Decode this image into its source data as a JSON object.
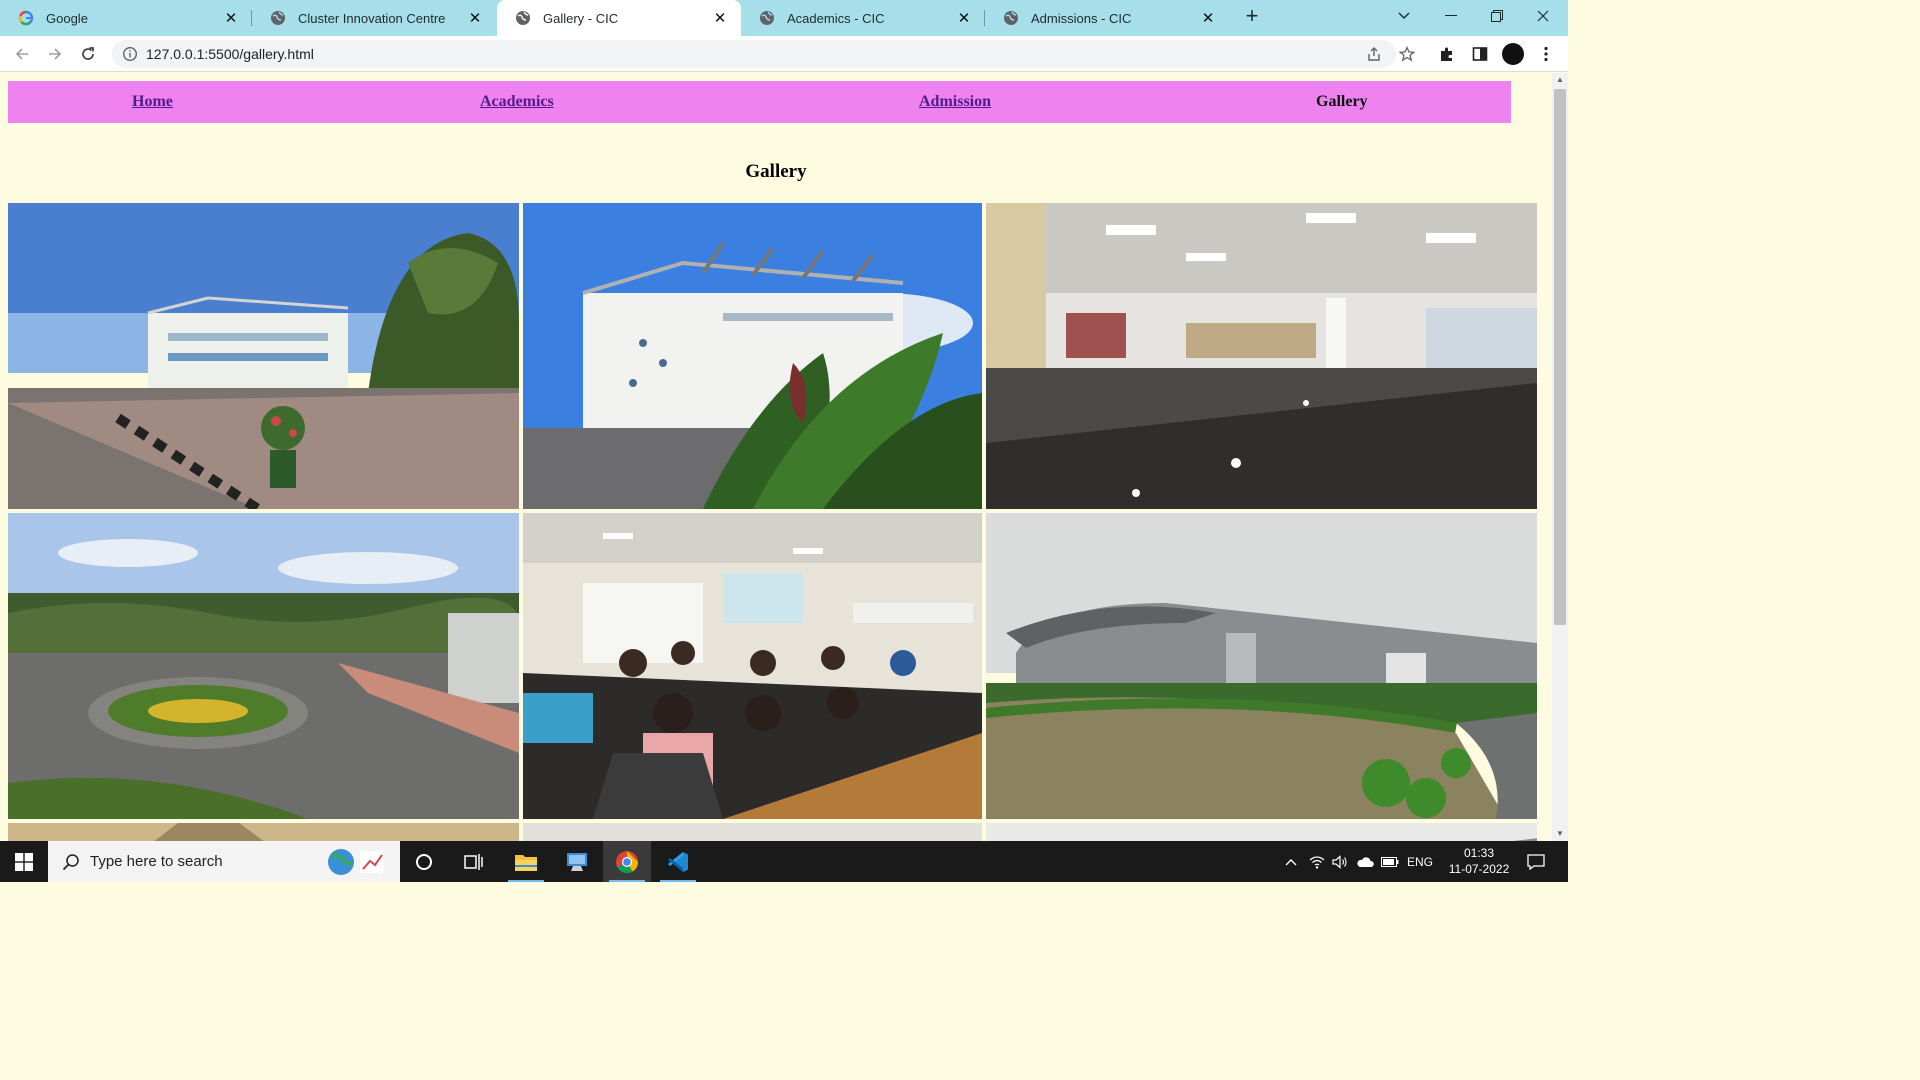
{
  "browser": {
    "tabs": [
      {
        "title": "Google",
        "favicon": "google-icon"
      },
      {
        "title": "Cluster Innovation Centre",
        "favicon": "globe-icon"
      },
      {
        "title": "Gallery - CIC",
        "favicon": "globe-icon",
        "active": true
      },
      {
        "title": "Academics - CIC",
        "favicon": "globe-icon"
      },
      {
        "title": "Admissions - CIC",
        "favicon": "globe-icon"
      }
    ],
    "url": "127.0.0.1:5500/gallery.html"
  },
  "page": {
    "nav": {
      "home": "Home",
      "academics": "Academics",
      "admission": "Admission",
      "gallery": "Gallery"
    },
    "heading": "Gallery",
    "photos": [
      {
        "name": "photo-campus-building-plaza"
      },
      {
        "name": "photo-university-stadium-building"
      },
      {
        "name": "photo-marble-hall-interior"
      },
      {
        "name": "photo-aerial-roundabout-garden"
      },
      {
        "name": "photo-classroom-lecture"
      },
      {
        "name": "photo-modern-building-lawn"
      }
    ]
  },
  "taskbar": {
    "search_placeholder": "Type here to search",
    "language": "ENG",
    "time": "01:33",
    "date": "11-07-2022"
  },
  "colors": {
    "navbar": "#ee82ee",
    "page_background": "#fdfbe0",
    "tabstrip": "#a6dfe9",
    "link": "#551a8b"
  }
}
